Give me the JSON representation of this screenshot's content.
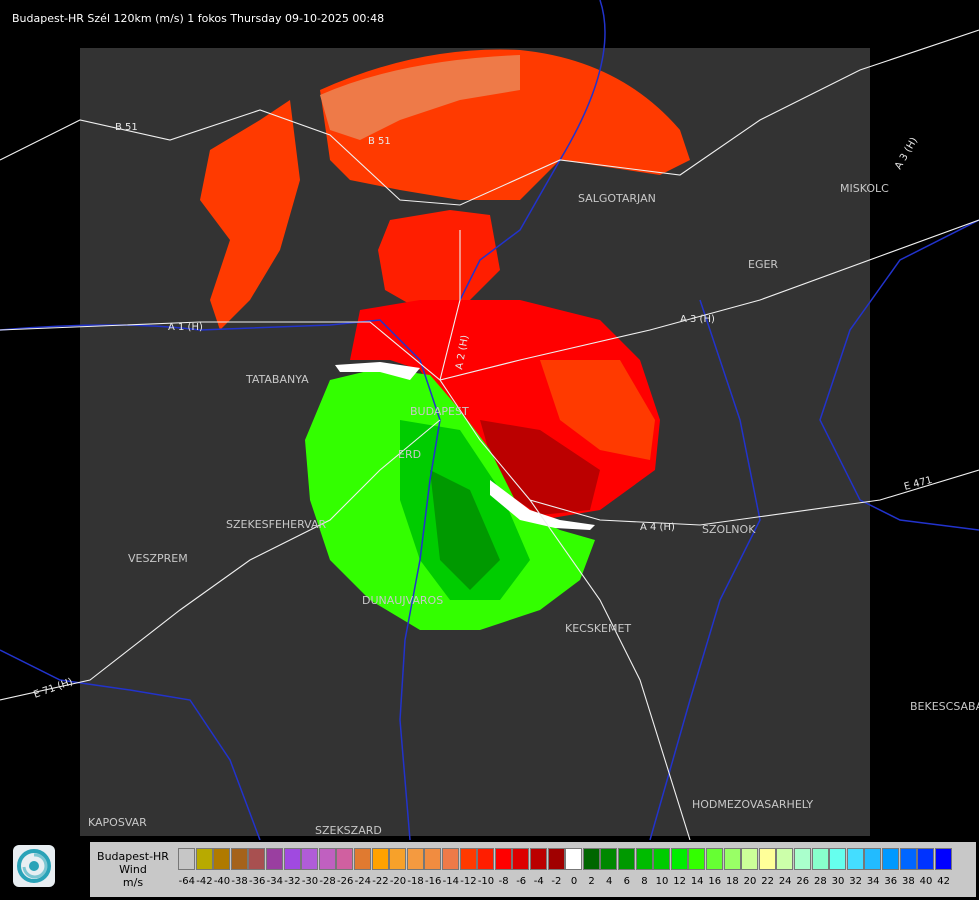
{
  "title": "Budapest-HR Szél 120km (m/s) 1 fokos Thursday 09-10-2025 00:48",
  "cities": [
    "SALGOTARJAN",
    "MISKOLC",
    "EGER",
    "TATABANYA",
    "BUDAPEST",
    "ERD",
    "SZEKESFEHERVAR",
    "VESZPREM",
    "DUNAUJVAROS",
    "KECSKEMET",
    "SZOLNOK",
    "BEKESCSABA",
    "HODMEZOVASARHELY",
    "KAPOSVAR",
    "SZEKSZARD"
  ],
  "roads": [
    "B 51",
    "B 51",
    "A 3 (H)",
    "A 3 (H)",
    "A 1 (H)",
    "A 2 (H)",
    "A 4 (H)",
    "E 471",
    "E 71 (H)"
  ],
  "legend": {
    "title": "Budapest-HR",
    "subtitle": "Wind",
    "unit": "m/s",
    "ticks": [
      "-64",
      "-42",
      "-40",
      "-38",
      "-36",
      "-34",
      "-32",
      "-30",
      "-28",
      "-26",
      "-24",
      "-22",
      "-20",
      "-18",
      "-16",
      "-14",
      "-12",
      "-10",
      "-8",
      "-6",
      "-4",
      "-2",
      "0",
      "2",
      "4",
      "6",
      "8",
      "10",
      "12",
      "14",
      "16",
      "18",
      "20",
      "22",
      "24",
      "26",
      "28",
      "30",
      "32",
      "34",
      "36",
      "38",
      "40",
      "42"
    ],
    "colors": [
      "#c6c6c6",
      "#b8aa00",
      "#b07a00",
      "#a5621a",
      "#a85050",
      "#9a3fa0",
      "#a04ae0",
      "#b05cd8",
      "#c060c0",
      "#d060a0",
      "#e07a30",
      "#ffa200",
      "#f7a12a",
      "#f49a40",
      "#f18c40",
      "#ee7a48",
      "#ff3a00",
      "#ff1e00",
      "#ff0000",
      "#dd0000",
      "#bb0000",
      "#a00000",
      "#ffffff",
      "#006600",
      "#008800",
      "#009900",
      "#00bb00",
      "#00cc00",
      "#00ee00",
      "#33ff00",
      "#66ff33",
      "#99ff66",
      "#ccff99",
      "#ffff99",
      "#ccffaa",
      "#aaffcc",
      "#88ffcc",
      "#66ffee",
      "#44ddff",
      "#22bbff",
      "#0099ff",
      "#0066ff",
      "#0033ff",
      "#0000ff"
    ]
  }
}
